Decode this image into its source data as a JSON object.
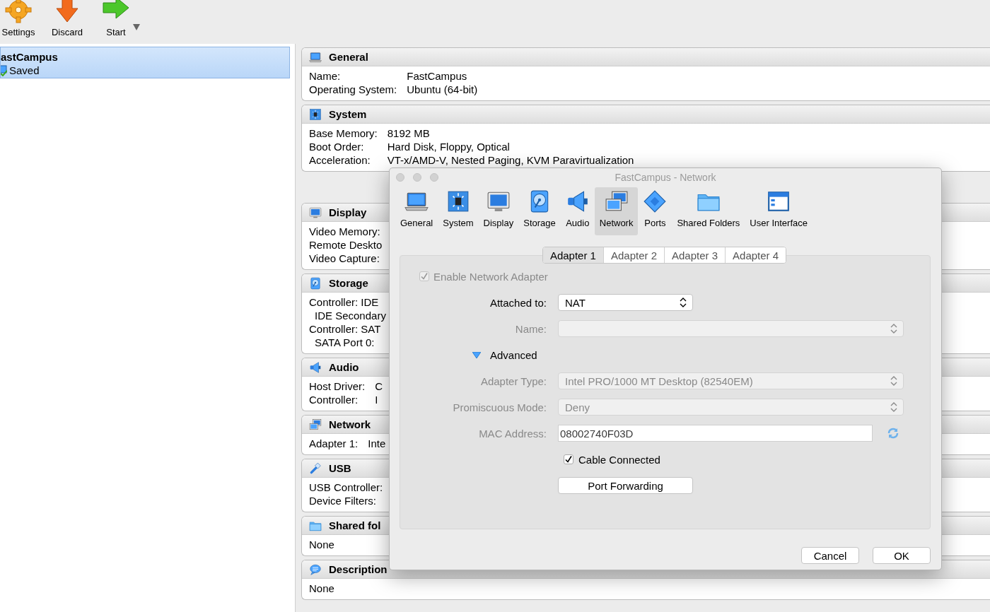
{
  "toolbar": [
    {
      "label": "Settings"
    },
    {
      "label": "Discard"
    },
    {
      "label": "Start",
      "has_menu": true
    }
  ],
  "vm_list": [
    {
      "name": "astCampus",
      "state": "Saved",
      "selected": true
    }
  ],
  "details": [
    {
      "title": "General",
      "rows": [
        {
          "label": "Name:",
          "value": "FastCampus"
        },
        {
          "label": "Operating System:",
          "value": "Ubuntu (64-bit)"
        }
      ]
    },
    {
      "title": "System",
      "rows": [
        {
          "label": "Base Memory:",
          "value": "8192 MB"
        },
        {
          "label": "Boot Order:",
          "value": "Hard Disk, Floppy, Optical"
        },
        {
          "label": "Acceleration:",
          "value": "VT-x/AMD-V, Nested Paging, KVM Paravirtualization"
        }
      ]
    },
    {
      "title": "Display",
      "rows": [
        {
          "label": "Video Memory:"
        },
        {
          "label": "Remote Deskto"
        },
        {
          "label": "Video Capture:"
        }
      ]
    },
    {
      "title": "Storage",
      "rows": [
        {
          "label": "Controller: IDE",
          "children": [
            {
              "label": "IDE Secondary"
            }
          ]
        },
        {
          "label": "Controller: SAT",
          "children": [
            {
              "label": "SATA Port 0:"
            }
          ]
        }
      ]
    },
    {
      "title": "Audio",
      "rows": [
        {
          "label": "Host Driver:",
          "value": "C"
        },
        {
          "label": "Controller:",
          "value": "I"
        }
      ]
    },
    {
      "title": "Network",
      "rows": [
        {
          "label": "Adapter 1:",
          "value": "Inte"
        }
      ]
    },
    {
      "title": "USB",
      "rows": [
        {
          "label": "USB Controller:"
        },
        {
          "label": "Device Filters:"
        }
      ]
    },
    {
      "title": "Shared fol",
      "rows": [
        {
          "label": "None"
        }
      ]
    },
    {
      "title": "Description",
      "rows": [
        {
          "label": "None"
        }
      ]
    }
  ],
  "dialog": {
    "title": "FastCampus - Network",
    "categories": [
      {
        "label": "General",
        "selected": false
      },
      {
        "label": "System",
        "selected": false
      },
      {
        "label": "Display",
        "selected": false
      },
      {
        "label": "Storage",
        "selected": false
      },
      {
        "label": "Audio",
        "selected": false
      },
      {
        "label": "Network",
        "selected": true
      },
      {
        "label": "Ports",
        "selected": false
      },
      {
        "label": "Shared Folders",
        "selected": false
      },
      {
        "label": "User Interface",
        "selected": false
      }
    ],
    "adapter_tabs": [
      {
        "label": "Adapter 1",
        "selected": true
      },
      {
        "label": "Adapter 2",
        "selected": false
      },
      {
        "label": "Adapter 3",
        "selected": false
      },
      {
        "label": "Adapter 4",
        "selected": false
      }
    ],
    "enable_adapter": {
      "label": "Enable Network Adapter",
      "checked": true,
      "disabled": true
    },
    "fields": [
      {
        "kind": "select",
        "label": "Attached to:",
        "value": "NAT",
        "disabled": false
      },
      {
        "kind": "select",
        "label": "Name:",
        "disabled": true
      },
      {
        "kind": "disclosure",
        "label": "Advanced",
        "expanded": true
      },
      {
        "kind": "select",
        "label": "Adapter Type:",
        "value": "Intel PRO/1000 MT Desktop (82540EM)",
        "disabled": true
      },
      {
        "kind": "select",
        "label": "Promiscuous Mode:",
        "value": "Deny",
        "disabled": true
      },
      {
        "kind": "text",
        "label": "MAC Address:",
        "value": "08002740F03D",
        "disabled": true
      },
      {
        "kind": "checkbox",
        "label": "Cable Connected",
        "checked": true
      },
      {
        "kind": "button",
        "label": "Port Forwarding"
      }
    ],
    "buttons": [
      "Cancel",
      "OK"
    ]
  }
}
